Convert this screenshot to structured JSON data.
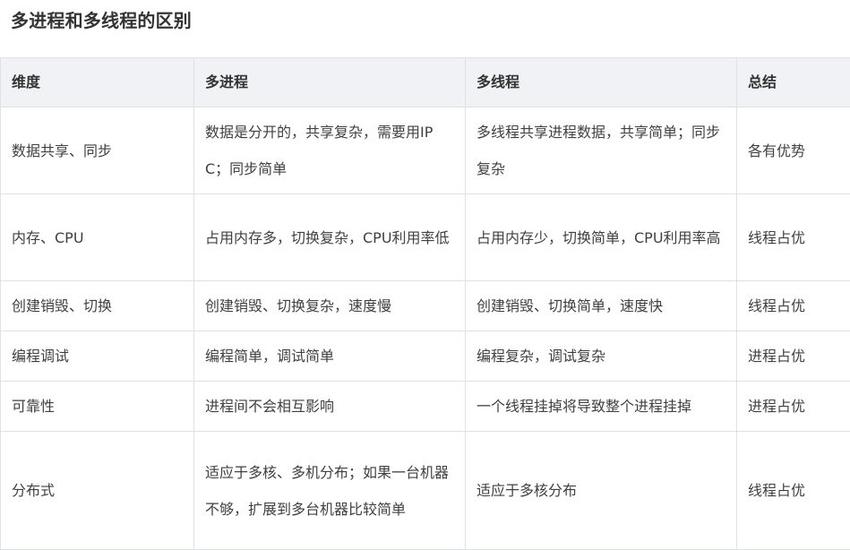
{
  "title": "多进程和多线程的区别",
  "table": {
    "headers": [
      "维度",
      "多进程",
      "多线程",
      "总结"
    ],
    "rows": [
      [
        "数据共享、同步",
        "数据是分开的，共享复杂，需要用IPC；同步简单",
        "多线程共享进程数据，共享简单；同步复杂",
        "各有优势"
      ],
      [
        "内存、CPU",
        "占用内存多，切换复杂，CPU利用率低",
        "占用内存少，切换简单，CPU利用率高",
        "线程占优"
      ],
      [
        "创建销毁、切换",
        "创建销毁、切换复杂，速度慢",
        "创建销毁、切换简单，速度快",
        "线程占优"
      ],
      [
        "编程调试",
        "编程简单，调试简单",
        "编程复杂，调试复杂",
        "进程占优"
      ],
      [
        "可靠性",
        "进程间不会相互影响",
        "一个线程挂掉将导致整个进程挂掉",
        "进程占优"
      ],
      [
        "分布式",
        "适应于多核、多机分布；如果一台机器不够，扩展到多台机器比较简单",
        "适应于多核分布",
        "线程占优"
      ]
    ]
  }
}
